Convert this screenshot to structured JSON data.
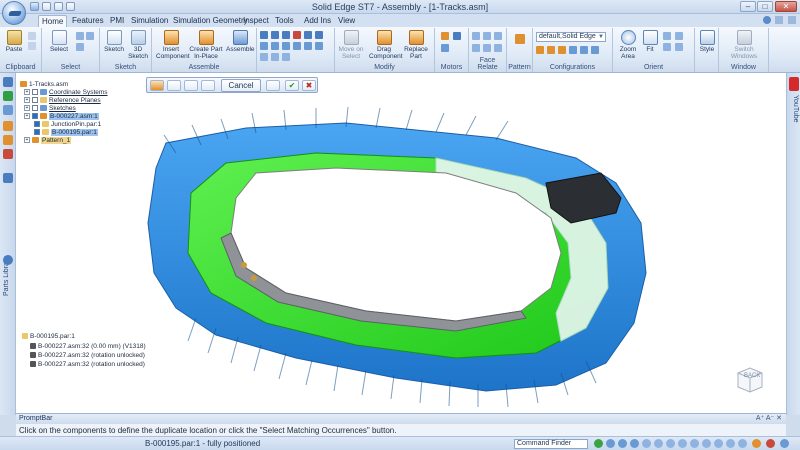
{
  "window": {
    "title": "Solid Edge ST7 - Assembly - [1-Tracks.asm]",
    "minimize": "–",
    "maximize": "□",
    "close": "✕"
  },
  "tabs": [
    "Home",
    "Features",
    "PMI",
    "Simulation",
    "Simulation Geometry",
    "Inspect",
    "Tools",
    "Add Ins",
    "View"
  ],
  "ribbon": {
    "groups": {
      "clipboard": "Clipboard",
      "select": "Select",
      "sketch": "Sketch",
      "assemble": "Assemble",
      "modify": "Modify",
      "motors": "Motors",
      "face_relate": "Face Relate",
      "pattern": "Pattern",
      "configurations": "Configurations",
      "orient": "Orient",
      "style": "Style",
      "window": "Window"
    },
    "buttons": {
      "paste": "Paste",
      "select": "Select",
      "sketch": "Sketch",
      "sketch3d": "3D Sketch",
      "insert_component": "Insert Component",
      "create_part_in_place": "Create Part In-Place",
      "assemble": "Assemble",
      "move_on_select": "Move on Select",
      "drag_component": "Drag Component",
      "replace_part": "Replace Part",
      "zoom_area": "Zoom Area",
      "fit": "Fit",
      "style": "Style",
      "switch_windows": "Switch Windows"
    },
    "configuration_value": "default,Solid Edge"
  },
  "command_bar": {
    "cancel": "Cancel",
    "accept": "✔",
    "reject": "✖"
  },
  "tree": {
    "root": "1-Tracks.asm",
    "items": [
      {
        "label": "Coordinate Systems"
      },
      {
        "label": "Reference Planes"
      },
      {
        "label": "Sketches"
      },
      {
        "label": "B-000227.asm:1"
      },
      {
        "label": "JunctionPin.par:1"
      },
      {
        "label": "B-000195.par:1"
      },
      {
        "label": "Pattern_1"
      }
    ]
  },
  "relations": {
    "header": "B-000195.par:1",
    "items": [
      "B-000227.asm:32 (0.00 mm) (V1318)",
      "B-000227.asm:32 (rotation unlocked)",
      "B-000227.asm:32 (rotation unlocked)"
    ]
  },
  "viewcube": {
    "face": "BACK"
  },
  "side_tabs": {
    "left": "Parts Library",
    "right": "YouTube"
  },
  "promptbar": {
    "title": "PromptBar",
    "text": "Click on the components to define the duplicate location or click the \"Select Matching Occurrences\" button.",
    "controls": "A⁺ A⁻ ✕"
  },
  "statusbar": {
    "text": "B-000195.par:1 - fully positioned",
    "command_finder": "Command Finder"
  },
  "colors": {
    "track_blue": "#2f8fe6",
    "link_green": "#33e626",
    "selection_white": "#e9f7f4",
    "ribbon_bg": "#dde8f6"
  }
}
